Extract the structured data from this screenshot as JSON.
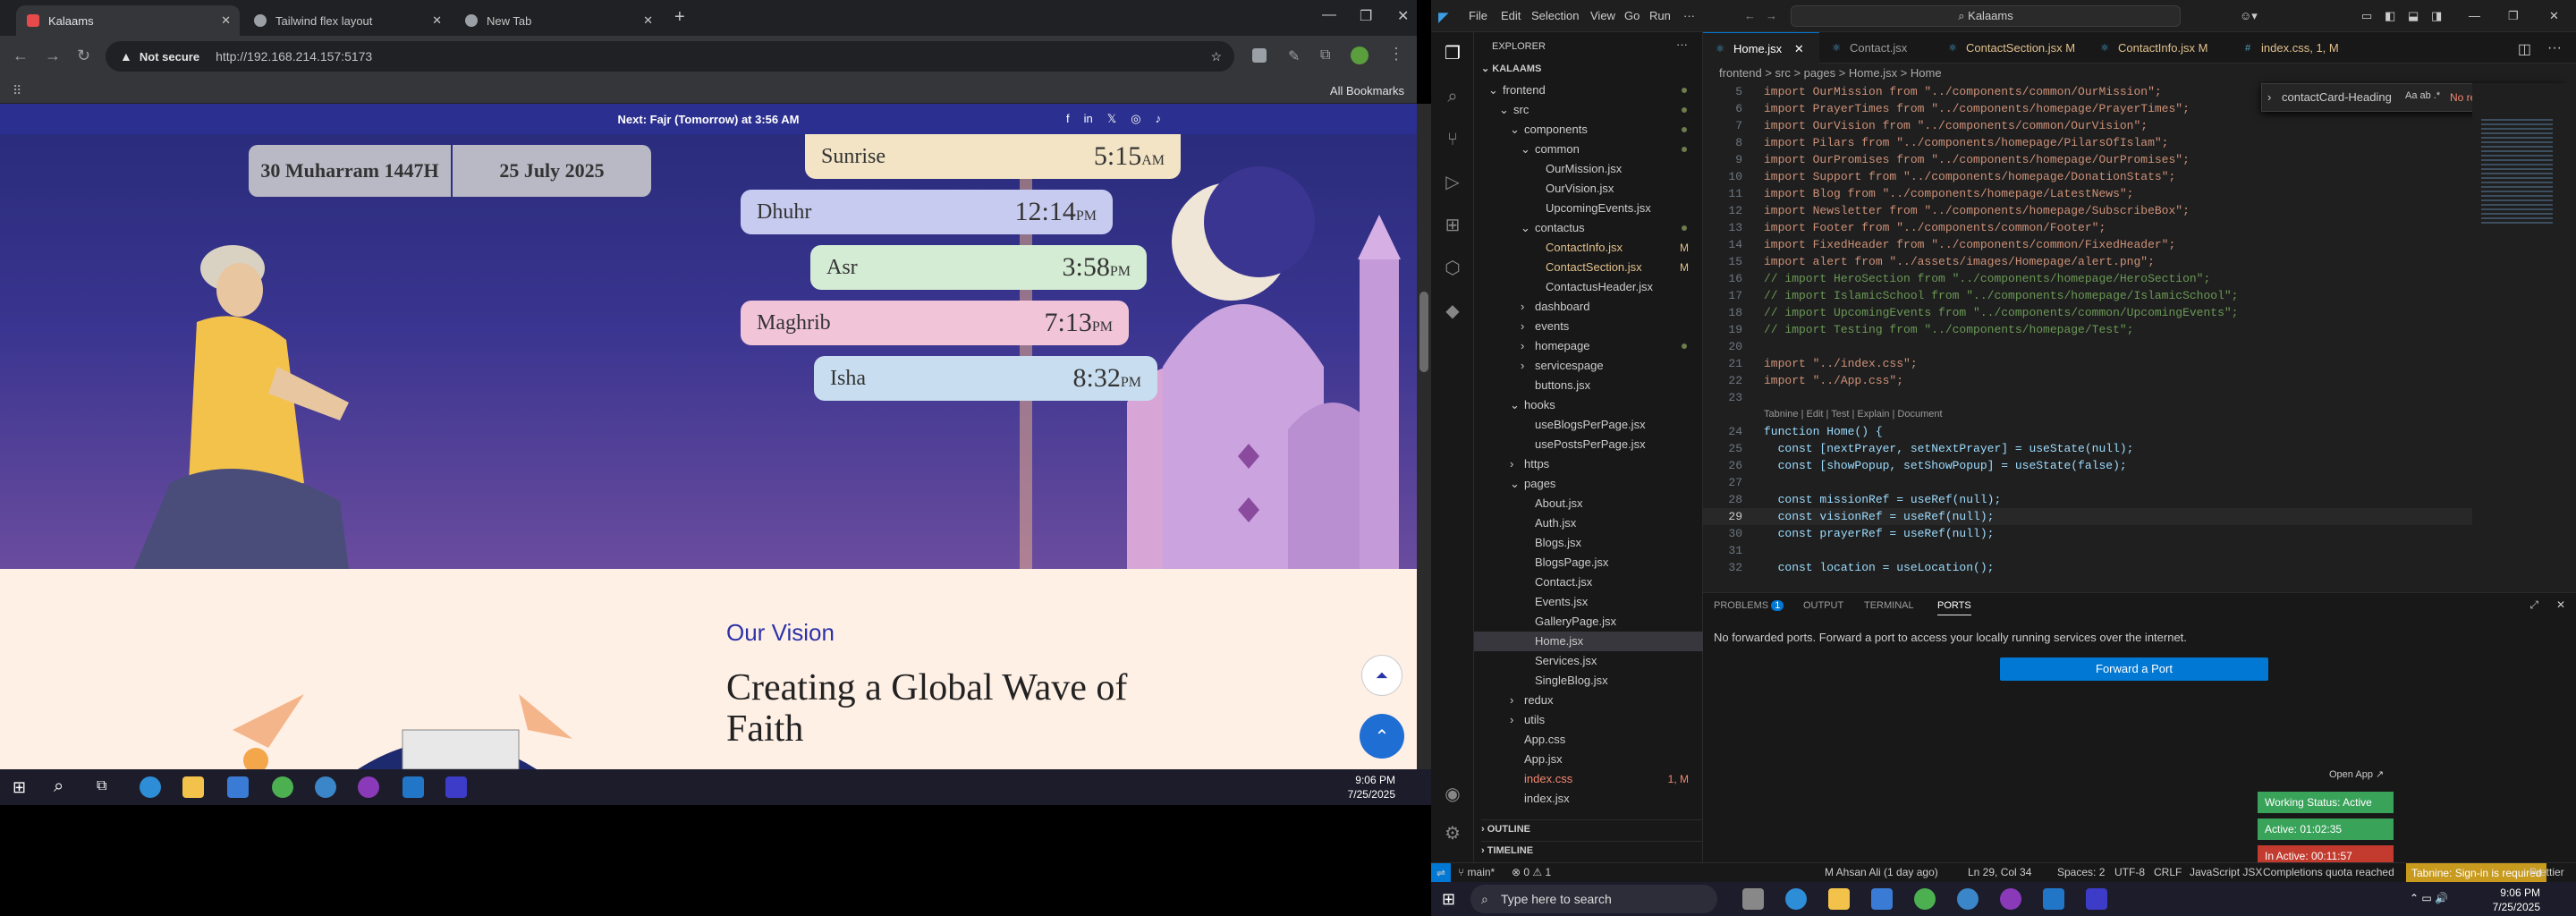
{
  "chrome": {
    "tabs": [
      {
        "title": "Kalaams",
        "active": true
      },
      {
        "title": "Tailwind flex layout",
        "active": false
      },
      {
        "title": "New Tab",
        "active": false
      }
    ],
    "not_secure": "Not secure",
    "url": "http://192.168.214.157:5173",
    "all_bookmarks": "All Bookmarks"
  },
  "site": {
    "announcement": "Next: Fajr (Tomorrow) at 3:56 AM",
    "hijri_date": "30 Muharram 1447H",
    "gregorian_date": "25 July 2025",
    "prayers": [
      {
        "name": "Sunrise",
        "time": "5:15",
        "ampm": "AM"
      },
      {
        "name": "Dhuhr",
        "time": "12:14",
        "ampm": "PM"
      },
      {
        "name": "Asr",
        "time": "3:58",
        "ampm": "PM"
      },
      {
        "name": "Maghrib",
        "time": "7:13",
        "ampm": "PM"
      },
      {
        "name": "Isha",
        "time": "8:32",
        "ampm": "PM"
      }
    ],
    "vision_label": "Our Vision",
    "vision_heading": "Creating a Global Wave of Faith"
  },
  "left_taskbar": {
    "time": "9:06 PM",
    "date": "7/25/2025"
  },
  "vscode": {
    "menu": [
      "File",
      "Edit",
      "Selection",
      "View",
      "Go",
      "Run",
      "···"
    ],
    "command_center": "Kalaams",
    "explorer_title": "EXPLORER",
    "root": "KALAAMS",
    "tree": [
      {
        "label": "frontend",
        "indent": 0,
        "type": "folder-open",
        "badge": "dot"
      },
      {
        "label": "src",
        "indent": 1,
        "type": "folder-open",
        "badge": "dot"
      },
      {
        "label": "components",
        "indent": 2,
        "type": "folder-open",
        "badge": "dot"
      },
      {
        "label": "common",
        "indent": 3,
        "type": "folder-open",
        "badge": "dot"
      },
      {
        "label": "OurMission.jsx",
        "indent": 4,
        "type": "file",
        "badge": ""
      },
      {
        "label": "OurVision.jsx",
        "indent": 4,
        "type": "file",
        "badge": ""
      },
      {
        "label": "UpcomingEvents.jsx",
        "indent": 4,
        "type": "file",
        "badge": ""
      },
      {
        "label": "contactus",
        "indent": 3,
        "type": "folder-open",
        "badge": "dot"
      },
      {
        "label": "ContactInfo.jsx",
        "indent": 4,
        "type": "file",
        "badge": "M"
      },
      {
        "label": "ContactSection.jsx",
        "indent": 4,
        "type": "file",
        "badge": "M"
      },
      {
        "label": "ContactusHeader.jsx",
        "indent": 4,
        "type": "file",
        "badge": ""
      },
      {
        "label": "dashboard",
        "indent": 3,
        "type": "folder",
        "badge": ""
      },
      {
        "label": "events",
        "indent": 3,
        "type": "folder",
        "badge": ""
      },
      {
        "label": "homepage",
        "indent": 3,
        "type": "folder",
        "badge": "dot"
      },
      {
        "label": "servicespage",
        "indent": 3,
        "type": "folder",
        "badge": ""
      },
      {
        "label": "buttons.jsx",
        "indent": 3,
        "type": "file",
        "badge": ""
      },
      {
        "label": "hooks",
        "indent": 2,
        "type": "folder-open",
        "badge": ""
      },
      {
        "label": "useBlogsPerPage.jsx",
        "indent": 3,
        "type": "file",
        "badge": ""
      },
      {
        "label": "usePostsPerPage.jsx",
        "indent": 3,
        "type": "file",
        "badge": ""
      },
      {
        "label": "https",
        "indent": 2,
        "type": "folder",
        "badge": ""
      },
      {
        "label": "pages",
        "indent": 2,
        "type": "folder-open",
        "badge": ""
      },
      {
        "label": "About.jsx",
        "indent": 3,
        "type": "file",
        "badge": ""
      },
      {
        "label": "Auth.jsx",
        "indent": 3,
        "type": "file",
        "badge": ""
      },
      {
        "label": "Blogs.jsx",
        "indent": 3,
        "type": "file",
        "badge": ""
      },
      {
        "label": "BlogsPage.jsx",
        "indent": 3,
        "type": "file",
        "badge": ""
      },
      {
        "label": "Contact.jsx",
        "indent": 3,
        "type": "file",
        "badge": ""
      },
      {
        "label": "Events.jsx",
        "indent": 3,
        "type": "file",
        "badge": ""
      },
      {
        "label": "GalleryPage.jsx",
        "indent": 3,
        "type": "file",
        "badge": ""
      },
      {
        "label": "Home.jsx",
        "indent": 3,
        "type": "file",
        "badge": "",
        "selected": true
      },
      {
        "label": "Services.jsx",
        "indent": 3,
        "type": "file",
        "badge": ""
      },
      {
        "label": "SingleBlog.jsx",
        "indent": 3,
        "type": "file",
        "badge": ""
      },
      {
        "label": "redux",
        "indent": 2,
        "type": "folder",
        "badge": ""
      },
      {
        "label": "utils",
        "indent": 2,
        "type": "folder",
        "badge": ""
      },
      {
        "label": "App.css",
        "indent": 2,
        "type": "file",
        "badge": ""
      },
      {
        "label": "App.jsx",
        "indent": 2,
        "type": "file",
        "badge": ""
      },
      {
        "label": "index.css",
        "indent": 2,
        "type": "file",
        "badge": "1, M"
      },
      {
        "label": "index.jsx",
        "indent": 2,
        "type": "file",
        "badge": ""
      }
    ],
    "outline": "OUTLINE",
    "timeline": "TIMELINE",
    "editor_tabs": [
      {
        "label": "Home.jsx",
        "mod": "",
        "active": true
      },
      {
        "label": "Contact.jsx",
        "mod": "",
        "active": false
      },
      {
        "label": "ContactSection.jsx",
        "mod": "M",
        "active": false
      },
      {
        "label": "ContactInfo.jsx",
        "mod": "M",
        "active": false
      },
      {
        "label": "index.css",
        "mod": "1, M",
        "active": false
      }
    ],
    "breadcrumbs": "frontend > src > pages > Home.jsx > Home",
    "find_value": "contactCard-Heading",
    "find_result": "No results",
    "codelens": "Tabnine | Edit | Test | Explain | Document",
    "code": [
      {
        "n": "5",
        "t": "import OurMission from \"../components/common/OurMission\";"
      },
      {
        "n": "6",
        "t": "import PrayerTimes from \"../components/homepage/PrayerTimes\";"
      },
      {
        "n": "7",
        "t": "import OurVision from \"../components/common/OurVision\";"
      },
      {
        "n": "8",
        "t": "import Pilars from \"../components/homepage/PilarsOfIslam\";"
      },
      {
        "n": "9",
        "t": "import OurPromises from \"../components/homepage/OurPromises\";"
      },
      {
        "n": "10",
        "t": "import Support from \"../components/homepage/DonationStats\";"
      },
      {
        "n": "11",
        "t": "import Blog from \"../components/homepage/LatestNews\";"
      },
      {
        "n": "12",
        "t": "import Newsletter from \"../components/homepage/SubscribeBox\";"
      },
      {
        "n": "13",
        "t": "import Footer from \"../components/common/Footer\";"
      },
      {
        "n": "14",
        "t": "import FixedHeader from \"../components/common/FixedHeader\";"
      },
      {
        "n": "15",
        "t": "import alert from \"../assets/images/Homepage/alert.png\";"
      },
      {
        "n": "16",
        "t": "// import HeroSection from \"../components/homepage/HeroSection\";"
      },
      {
        "n": "17",
        "t": "// import IslamicSchool from \"../components/homepage/IslamicSchool\";"
      },
      {
        "n": "18",
        "t": "// import UpcomingEvents from \"../components/common/UpcomingEvents\";"
      },
      {
        "n": "19",
        "t": "// import Testing from \"../components/homepage/Test\";"
      },
      {
        "n": "20",
        "t": ""
      },
      {
        "n": "21",
        "t": "import \"../index.css\";"
      },
      {
        "n": "22",
        "t": "import \"../App.css\";"
      },
      {
        "n": "23",
        "t": ""
      },
      {
        "n": "24",
        "t": "function Home() {"
      },
      {
        "n": "25",
        "t": "  const [nextPrayer, setNextPrayer] = useState(null);"
      },
      {
        "n": "26",
        "t": "  const [showPopup, setShowPopup] = useState(false);"
      },
      {
        "n": "27",
        "t": ""
      },
      {
        "n": "28",
        "t": "  const missionRef = useRef(null);"
      },
      {
        "n": "29",
        "t": "  const visionRef = useRef(null);"
      },
      {
        "n": "30",
        "t": "  const prayerRef = useRef(null);"
      },
      {
        "n": "31",
        "t": ""
      },
      {
        "n": "32",
        "t": "  const location = useLocation();"
      }
    ],
    "panel_tabs": [
      "PROBLEMS",
      "OUTPUT",
      "TERMINAL",
      "PORTS"
    ],
    "problems_count": "1",
    "ports_message": "No forwarded ports. Forward a port to access your locally running services over the internet.",
    "forward_button": "Forward a Port",
    "open_app": "Open App ↗",
    "working_status": "Working Status: Active",
    "active_time": "Active: 01:02:35",
    "inactive_time": "In Active: 00:11:57",
    "status": {
      "branch": "main*",
      "errors": "⊗ 0 ⚠ 1",
      "author": "M Ahsan Ali (1 day ago)",
      "position": "Ln 29, Col 34",
      "spaces": "Spaces: 2",
      "encoding": "UTF-8",
      "eol": "CRLF",
      "language": "JavaScript JSX",
      "quota": "Completions quota reached",
      "tabnine": "Tabnine: Sign-in is required",
      "prettier": "Prettier"
    }
  },
  "right_taskbar": {
    "search_placeholder": "Type here to search",
    "time": "9:06 PM",
    "date": "7/25/2025"
  }
}
